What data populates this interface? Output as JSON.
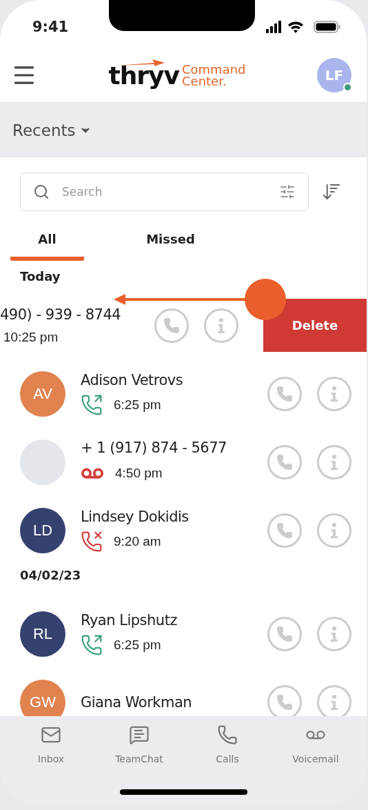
{
  "status_bar": {
    "time": "9:41"
  },
  "header": {
    "logo": {
      "brand": "thryv",
      "product_line1": "Command",
      "product_line2": "Center."
    },
    "avatar": {
      "initials": "LF",
      "online": true
    }
  },
  "view_selector": {
    "label": "Recents"
  },
  "search": {
    "placeholder": "Search"
  },
  "tabs": [
    {
      "label": "All",
      "selected": true
    },
    {
      "label": "Missed",
      "selected": false
    }
  ],
  "sections": [
    {
      "label": "Today",
      "rows": [
        {
          "name": "490) - 939 - 8744",
          "time": "10:25 pm",
          "swiped": true,
          "delete_label": "Delete"
        },
        {
          "name": "Adison Vetrovs",
          "time": "6:25 pm",
          "swiped": false,
          "kind": "outgoing",
          "avatar": {
            "initials": "AV",
            "color": "#e0834f"
          }
        },
        {
          "name": "+ 1 (917) 874 - 5677",
          "time": "4:50 pm",
          "swiped": false,
          "kind": "voicemail",
          "avatar": {
            "color": "#e3e6ea"
          }
        },
        {
          "name": "Lindsey Dokidis",
          "time": "9:20 am",
          "swiped": false,
          "kind": "missed",
          "avatar": {
            "initials": "LD",
            "color": "#35416f"
          }
        }
      ]
    },
    {
      "label": "04/02/23",
      "rows": [
        {
          "name": "Ryan Lipshutz",
          "time": "6:25 pm",
          "swiped": false,
          "kind": "outgoing",
          "avatar": {
            "initials": "RL",
            "color": "#35416f"
          }
        },
        {
          "name": "Giana Workman",
          "swiped": false,
          "avatar": {
            "initials": "GW",
            "color": "#e0834f"
          }
        }
      ]
    }
  ],
  "bottom_nav": [
    {
      "label": "Inbox",
      "kind": "inbox"
    },
    {
      "label": "TeamChat",
      "kind": "chat"
    },
    {
      "label": "Calls",
      "kind": "calls"
    },
    {
      "label": "Voicemail",
      "kind": "voicemail"
    }
  ]
}
